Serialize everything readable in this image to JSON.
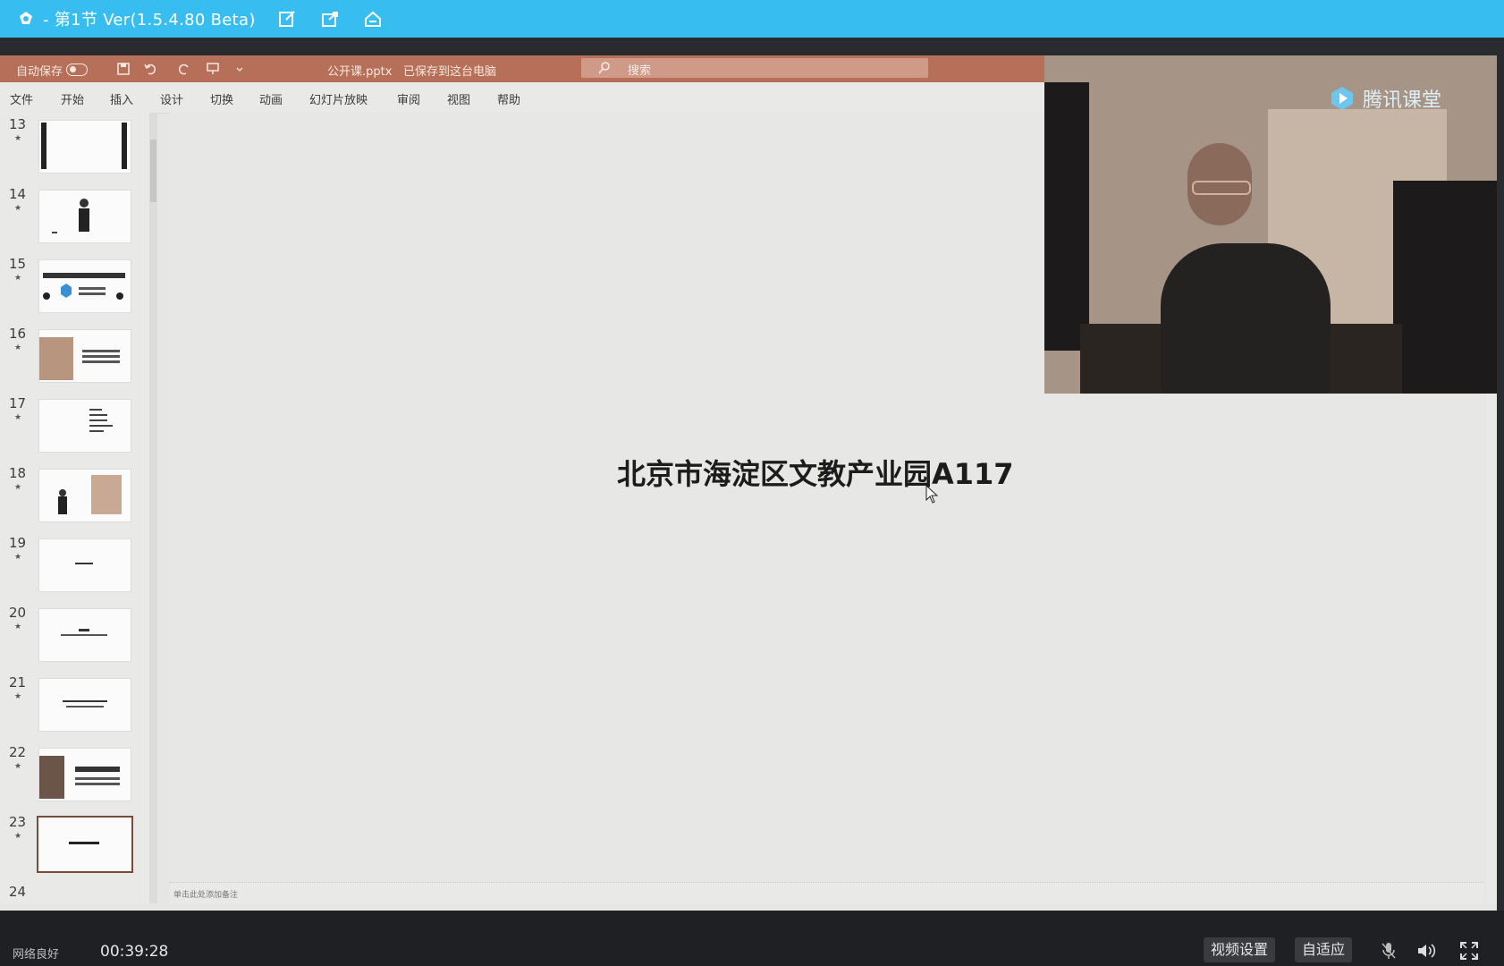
{
  "titlebar": {
    "title": "- 第1节 Ver(1.5.4.80 Beta)",
    "icons": [
      "note-icon",
      "share-icon",
      "home-icon"
    ]
  },
  "ppt": {
    "autosave_label": "自动保存",
    "filename": "公开课.pptx",
    "save_state": "已保存到这台电脑",
    "search_placeholder": "搜索",
    "tabs": [
      "文件",
      "开始",
      "插入",
      "设计",
      "切换",
      "动画",
      "幻灯片放映",
      "审阅",
      "视图",
      "帮助"
    ],
    "thumbnails": [
      {
        "num": "13",
        "marker": "★"
      },
      {
        "num": "14",
        "marker": "★"
      },
      {
        "num": "15",
        "marker": "★"
      },
      {
        "num": "16",
        "marker": "★"
      },
      {
        "num": "17",
        "marker": "★"
      },
      {
        "num": "18",
        "marker": "★"
      },
      {
        "num": "19",
        "marker": "★"
      },
      {
        "num": "20",
        "marker": "★"
      },
      {
        "num": "21",
        "marker": "★"
      },
      {
        "num": "22",
        "marker": "★"
      },
      {
        "num": "23",
        "marker": "★"
      },
      {
        "num": "24",
        "marker": ""
      }
    ],
    "active_slide": "23",
    "slide_text": "北京市海淀区文教产业园A117",
    "notes_hint": "单击此处添加备注"
  },
  "webcam": {
    "brand": "腾讯课堂"
  },
  "player": {
    "network": "网络良好",
    "time": "00:39:28",
    "video_settings": "视频设置",
    "adaptive": "自适应"
  },
  "colors": {
    "titlebar": "#38bdf0",
    "ppt_accent": "#b6705a",
    "player_bg": "#1f2023"
  }
}
